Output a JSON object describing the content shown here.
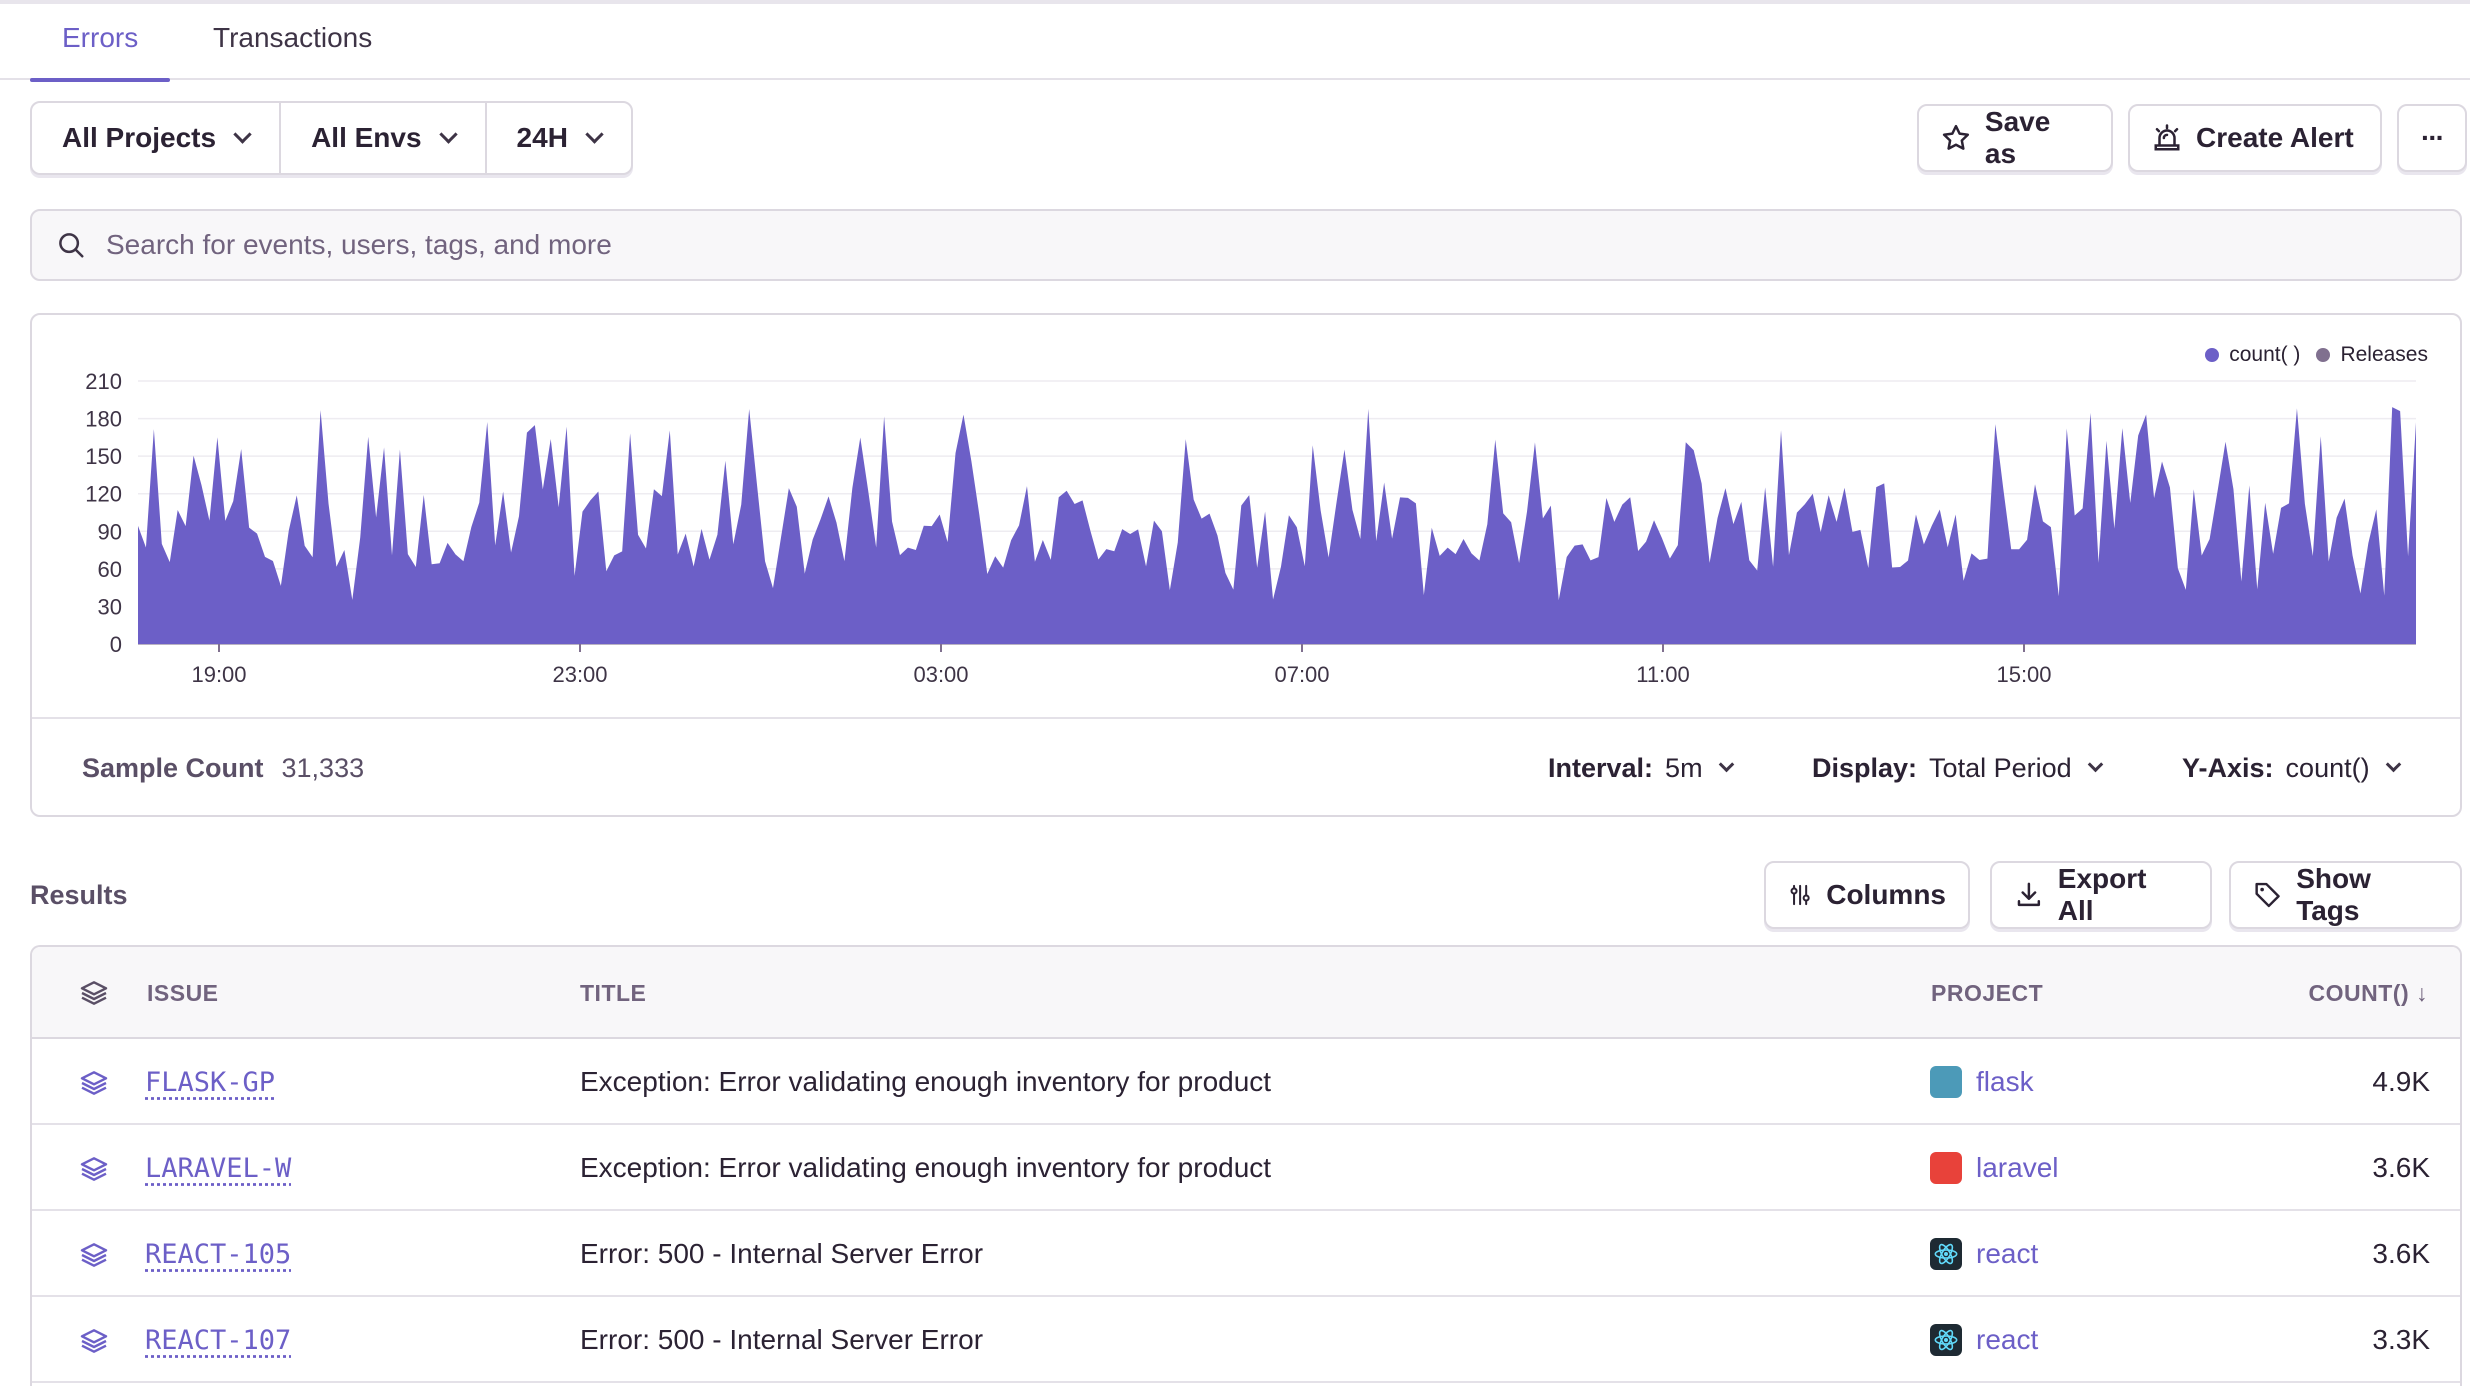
{
  "tabs": [
    {
      "label": "Errors",
      "active": true
    },
    {
      "label": "Transactions",
      "active": false
    }
  ],
  "filters": {
    "project": "All Projects",
    "env": "All Envs",
    "period": "24H"
  },
  "actions": {
    "save_as": "Save as",
    "create_alert": "Create Alert",
    "more": "···"
  },
  "search": {
    "placeholder": "Search for events, users, tags, and more"
  },
  "chart_data": {
    "type": "area",
    "series": [
      {
        "name": "count()",
        "color": "#6c5fc7"
      }
    ],
    "legend": [
      {
        "label": "count( )",
        "color": "#6c5fc7"
      },
      {
        "label": "Releases",
        "color": "#80708f"
      }
    ],
    "legend_position": "top-right",
    "y_ticks": [
      "0",
      "30",
      "60",
      "90",
      "120",
      "150",
      "180",
      "210"
    ],
    "ylim": [
      0,
      210
    ],
    "x_ticks": [
      "19:00",
      "23:00",
      "03:00",
      "07:00",
      "11:00",
      "15:00"
    ],
    "grid": true,
    "approx_range": [
      30,
      195
    ]
  },
  "chart_footer": {
    "sample_label": "Sample Count",
    "sample_value": "31,333",
    "interval_label": "Interval:",
    "interval_value": "5m",
    "display_label": "Display:",
    "display_value": "Total Period",
    "yaxis_label": "Y-Axis:",
    "yaxis_value": "count()"
  },
  "results": {
    "title": "Results",
    "columns_btn": "Columns",
    "export_btn": "Export All",
    "tags_btn": "Show Tags",
    "headers": {
      "issue": "ISSUE",
      "title": "TITLE",
      "project": "PROJECT",
      "count": "COUNT() ↓"
    },
    "rows": [
      {
        "issue": "FLASK-GP",
        "title": "Exception: Error validating enough inventory for product",
        "project": "flask",
        "project_color": "#4c9ab8",
        "count": "4.9K"
      },
      {
        "issue": "LARAVEL-W",
        "title": "Exception: Error validating enough inventory for product",
        "project": "laravel",
        "project_color": "#e8423a",
        "count": "3.6K"
      },
      {
        "issue": "REACT-105",
        "title": "Error: 500 - Internal Server Error",
        "project": "react",
        "project_color": "#1e2a33",
        "count": "3.6K"
      },
      {
        "issue": "REACT-107",
        "title": "Error: 500 - Internal Server Error",
        "project": "react",
        "project_color": "#1e2a33",
        "count": "3.3K"
      }
    ]
  }
}
